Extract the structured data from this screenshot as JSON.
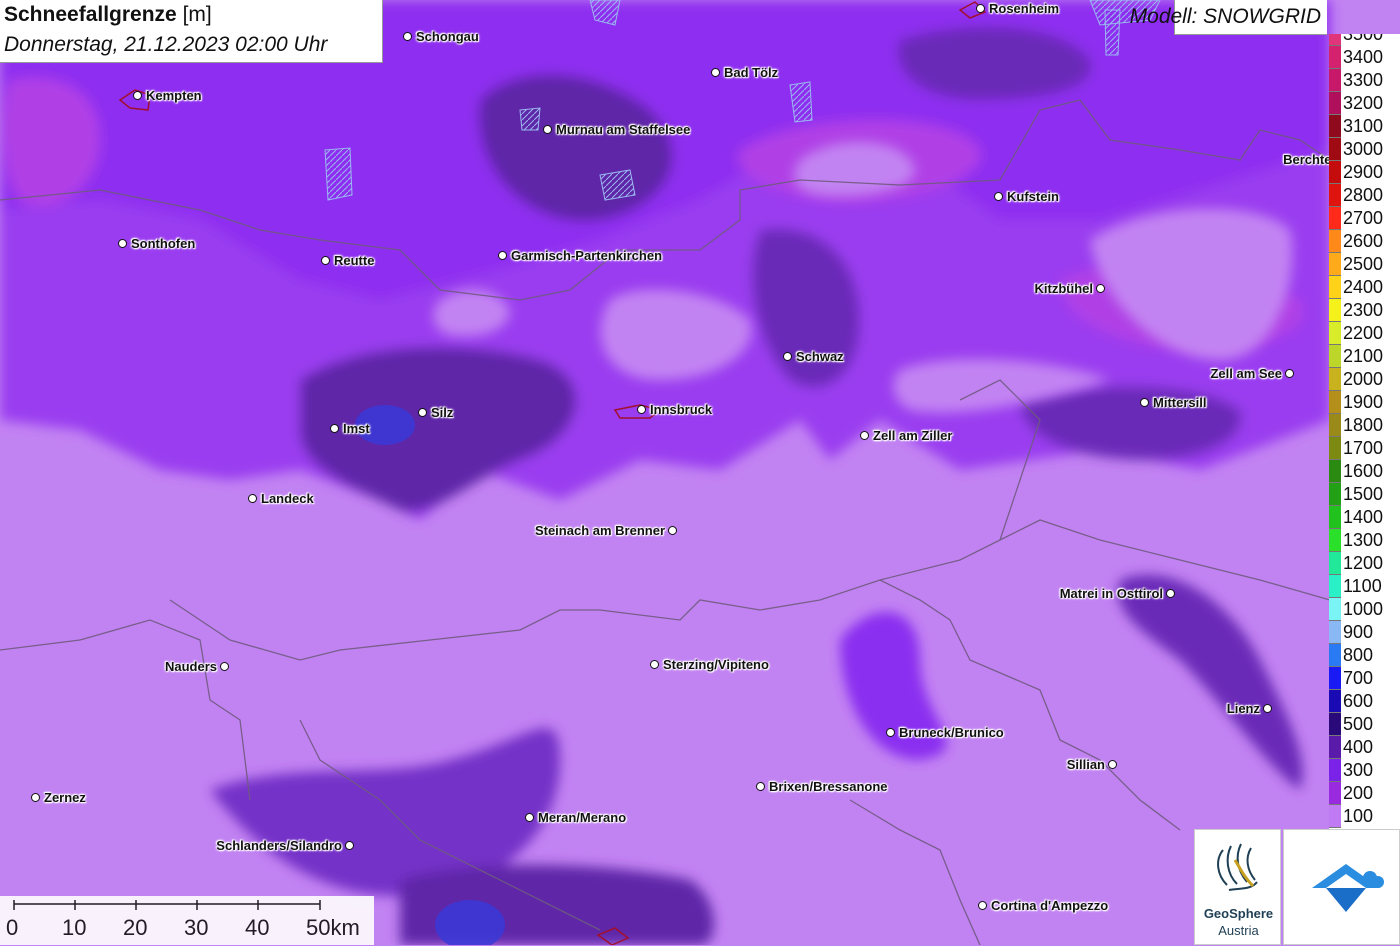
{
  "title": {
    "parameter": "Schneefallgrenze",
    "unit": "[m]",
    "datetime": "Donnerstag, 21.12.2023 02:00 Uhr"
  },
  "model": "Modell: SNOWGRID",
  "legend": {
    "levels": [
      {
        "label": "3500",
        "color": "#e0357a"
      },
      {
        "label": "3400",
        "color": "#d4226f"
      },
      {
        "label": "3300",
        "color": "#c8186a"
      },
      {
        "label": "3200",
        "color": "#b00f5c"
      },
      {
        "label": "3100",
        "color": "#8e0a1c"
      },
      {
        "label": "3000",
        "color": "#a00a12"
      },
      {
        "label": "2900",
        "color": "#c40c0c"
      },
      {
        "label": "2800",
        "color": "#e0140e"
      },
      {
        "label": "2700",
        "color": "#ff2a1a"
      },
      {
        "label": "2600",
        "color": "#ff8a1a"
      },
      {
        "label": "2500",
        "color": "#ffaa1a"
      },
      {
        "label": "2400",
        "color": "#ffd21a"
      },
      {
        "label": "2300",
        "color": "#f4f21a"
      },
      {
        "label": "2200",
        "color": "#d8ec2a"
      },
      {
        "label": "2100",
        "color": "#bcd62a"
      },
      {
        "label": "2000",
        "color": "#c8b21e"
      },
      {
        "label": "1900",
        "color": "#b4901a"
      },
      {
        "label": "1800",
        "color": "#9a8a1a"
      },
      {
        "label": "1700",
        "color": "#7c8a12"
      },
      {
        "label": "1600",
        "color": "#2a8a12"
      },
      {
        "label": "1500",
        "color": "#22a016"
      },
      {
        "label": "1400",
        "color": "#22c21e"
      },
      {
        "label": "1300",
        "color": "#2ae02a"
      },
      {
        "label": "1200",
        "color": "#22e89a"
      },
      {
        "label": "1100",
        "color": "#2af0c8"
      },
      {
        "label": "1000",
        "color": "#7af4f4"
      },
      {
        "label": "900",
        "color": "#8ab8f4"
      },
      {
        "label": "800",
        "color": "#2a7af4"
      },
      {
        "label": "700",
        "color": "#1a1af4"
      },
      {
        "label": "600",
        "color": "#1a0ab4"
      },
      {
        "label": "500",
        "color": "#2a0a7a"
      },
      {
        "label": "400",
        "color": "#5a1aaa"
      },
      {
        "label": "300",
        "color": "#7a22e8"
      },
      {
        "label": "200",
        "color": "#9a2ae0"
      },
      {
        "label": "100",
        "color": "#c07af4"
      }
    ]
  },
  "cities": [
    {
      "name": "Rosenheim"
    },
    {
      "name": "Schongau"
    },
    {
      "name": "Bad Tölz"
    },
    {
      "name": "Kempten"
    },
    {
      "name": "Murnau am Staffelsee"
    },
    {
      "name": "Berchtesgaden"
    },
    {
      "name": "Kufstein"
    },
    {
      "name": "Sonthofen"
    },
    {
      "name": "Reutte"
    },
    {
      "name": "Garmisch-Partenkirchen"
    },
    {
      "name": "Kitzbühel"
    },
    {
      "name": "Schwaz"
    },
    {
      "name": "Zell am See"
    },
    {
      "name": "Mittersill"
    },
    {
      "name": "Imst"
    },
    {
      "name": "Silz"
    },
    {
      "name": "Innsbruck"
    },
    {
      "name": "Zell am Ziller"
    },
    {
      "name": "Landeck"
    },
    {
      "name": "Steinach am Brenner"
    },
    {
      "name": "Matrei in Osttirol"
    },
    {
      "name": "Nauders"
    },
    {
      "name": "Sterzing/Vipiteno"
    },
    {
      "name": "Lienz"
    },
    {
      "name": "Bruneck/Brunico"
    },
    {
      "name": "Sillian"
    },
    {
      "name": "Zernez"
    },
    {
      "name": "Brixen/Bressanone"
    },
    {
      "name": "Meran/Merano"
    },
    {
      "name": "Schlanders/Silandro"
    },
    {
      "name": "Cortina d'Ampezzo"
    }
  ],
  "scale": {
    "labels": [
      "0",
      "10",
      "20",
      "30",
      "40",
      "50km"
    ]
  },
  "logos": {
    "geosphere_line1": "GeoSphere",
    "geosphere_line2": "Austria"
  }
}
